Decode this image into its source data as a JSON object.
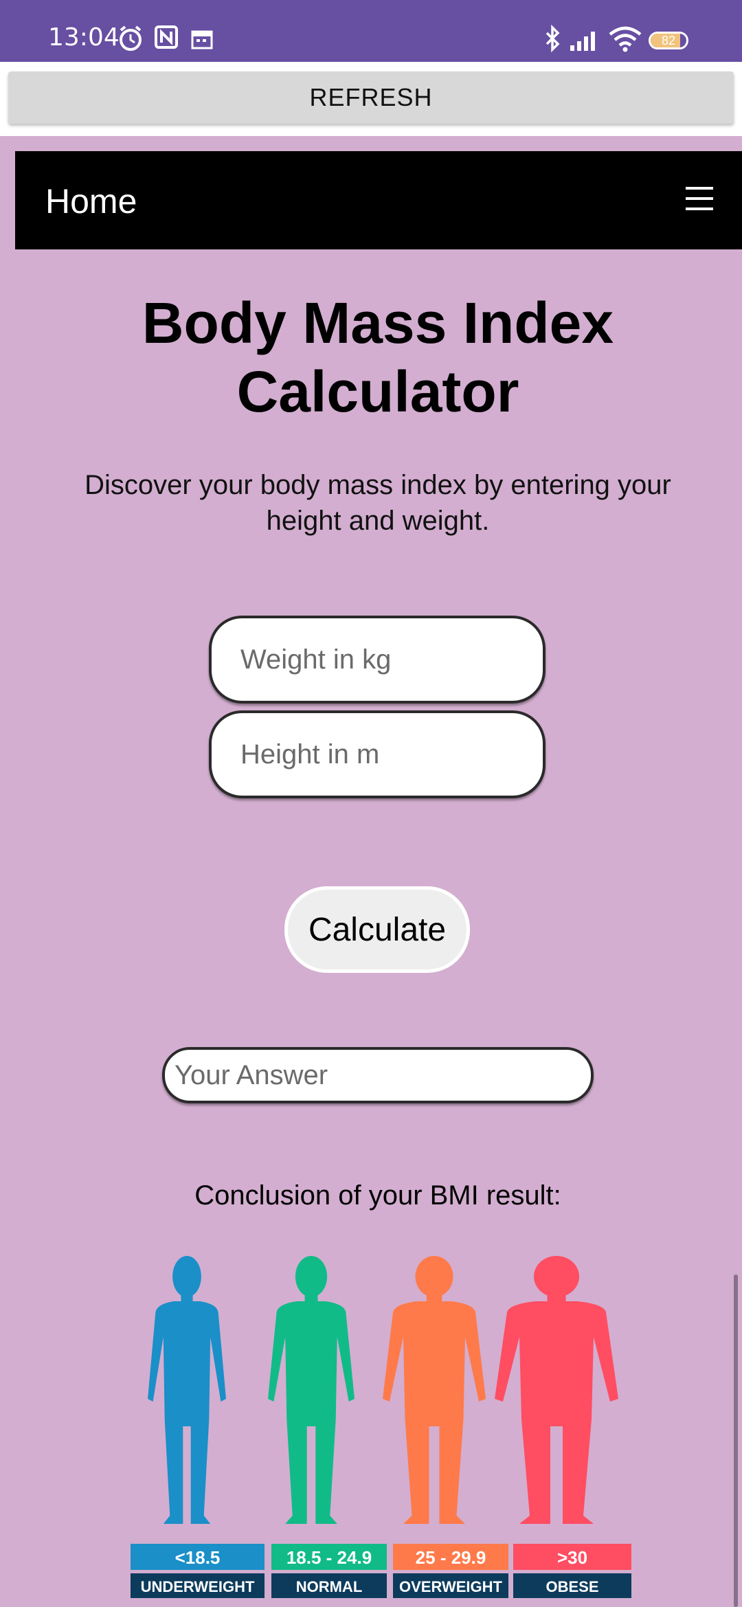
{
  "status_bar": {
    "time": "13:04",
    "battery": "82",
    "left_icons": [
      "alarm-icon",
      "nfc-icon",
      "calendar-icon"
    ],
    "right_icons": [
      "bluetooth-icon",
      "signal-icon",
      "wifi-icon",
      "battery-icon"
    ]
  },
  "refresh_button": {
    "label": "REFRESH"
  },
  "navbar": {
    "home_label": "Home",
    "menu_icon": "hamburger-menu-icon"
  },
  "main": {
    "title": "Body Mass Index Calculator",
    "subtitle": "Discover your body mass index by entering your height and weight.",
    "weight_placeholder": "Weight in kg",
    "height_placeholder": "Height in m",
    "calculate_label": "Calculate",
    "answer_placeholder": "Your Answer",
    "conclusion_label": "Conclusion of your BMI result:"
  },
  "bmi_chart": {
    "categories": [
      {
        "range": "<18.5",
        "label": "UNDERWEIGHT",
        "color": "#1a8fc8"
      },
      {
        "range": "18.5 - 24.9",
        "label": "NORMAL",
        "color": "#11bb88"
      },
      {
        "range": "25 - 29.9",
        "label": "OVERWEIGHT",
        "color": "#ff7a4a"
      },
      {
        "range": ">30",
        "label": "OBESE",
        "color": "#ff4d62"
      }
    ],
    "label_bg": "#0d3b5c"
  }
}
